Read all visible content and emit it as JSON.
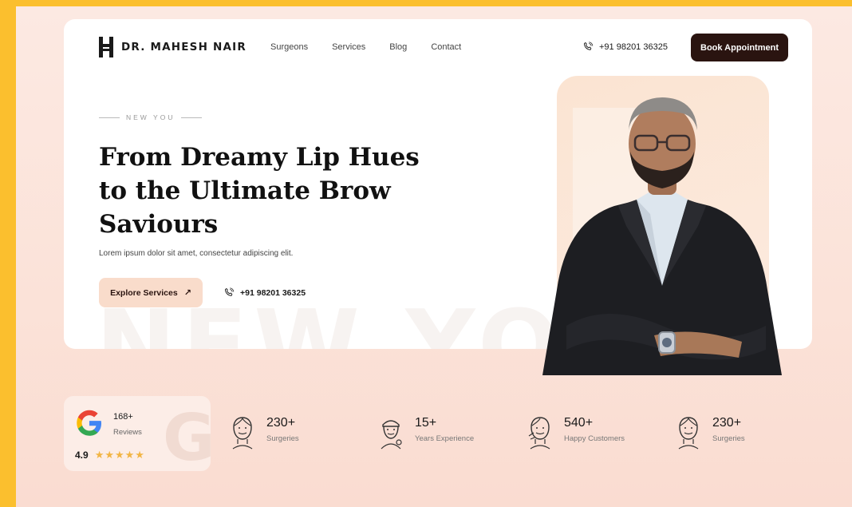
{
  "brand": {
    "name": "DR. MAHESH NAIR"
  },
  "nav": {
    "links": [
      "Surgeons",
      "Services",
      "Blog",
      "Contact"
    ],
    "phone": "+91 98201 36325",
    "cta": "Book Appointment"
  },
  "hero": {
    "eyebrow": "NEW YOU",
    "headline_lines": [
      "From Dreamy Lip Hues",
      "to the Ultimate Brow",
      "Saviours"
    ],
    "subtext": "Lorem ipsum dolor sit amet, consectetur adipiscing elit.",
    "explore_label": "Explore Services",
    "phone": "+91 98201 36325",
    "watermark": "NEW YOU"
  },
  "reviews": {
    "count": "168+",
    "label": "Reviews",
    "rating": "4.9",
    "stars": 5
  },
  "stats": [
    {
      "value": "230+",
      "label": "Surgeries",
      "icon": "face-outline-icon"
    },
    {
      "value": "15+",
      "label": "Years Experience",
      "icon": "surgeon-icon"
    },
    {
      "value": "540+",
      "label": "Happy Customers",
      "icon": "face-treatment-icon"
    },
    {
      "value": "230+",
      "label": "Surgeries",
      "icon": "face-outline-icon"
    }
  ],
  "colors": {
    "frame": "#FBBF2E",
    "page_bg": "#FCE9E2",
    "cta_dark": "#2A1410",
    "cta_light": "#F9DCCB",
    "star": "#F2B544"
  }
}
